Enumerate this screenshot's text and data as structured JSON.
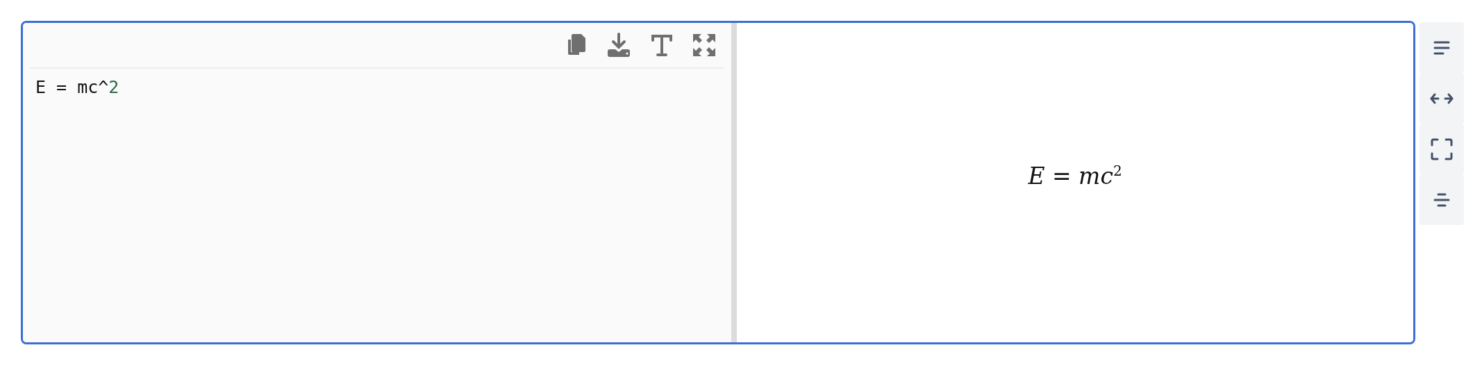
{
  "editor": {
    "toolbar": [
      {
        "kind": "copy"
      },
      {
        "kind": "download"
      },
      {
        "kind": "font"
      },
      {
        "kind": "expand"
      }
    ],
    "code_lines": [
      [
        {
          "text": "E = mc^",
          "kind": "plain"
        },
        {
          "text": "2",
          "kind": "number"
        }
      ]
    ]
  },
  "preview": {
    "formula": "*E* = *mc*$^{2}$"
  },
  "side_buttons": [
    {
      "kind": "wrap"
    },
    {
      "kind": "width"
    },
    {
      "kind": "fullscreen"
    },
    {
      "kind": "center"
    }
  ]
}
